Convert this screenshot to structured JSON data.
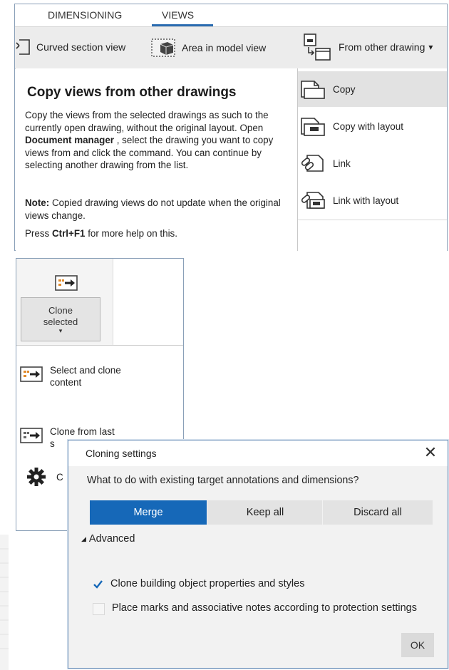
{
  "ribbon": {
    "tabs": [
      {
        "label": "DIMENSIONING"
      },
      {
        "label": "VIEWS"
      }
    ],
    "toolbar": {
      "curved_section": "Curved section view",
      "area_in_model": "Area in model view",
      "from_other_drawing": "From other drawing",
      "dropdown_caret": "▾"
    },
    "tooltip": {
      "title": "Copy views from other drawings",
      "body_part1": "Copy the views from the selected drawings as such to the currently open drawing, without the original layout. Open ",
      "body_bold": "Document manager",
      "body_part2": " , select the drawing you want to copy views from and click the command. You can continue by selecting another drawing from the list.",
      "note_label": "Note:",
      "note_text": " Copied drawing views do not update when the original views change.",
      "help_part1": "Press ",
      "help_shortcut": "Ctrl+F1",
      "help_part2": " for more help on this."
    },
    "menu": {
      "items": [
        {
          "label": "Copy",
          "icon": "copy-icon"
        },
        {
          "label": "Copy with layout",
          "icon": "copy-layout-icon"
        },
        {
          "label": "Link",
          "icon": "link-icon"
        },
        {
          "label": "Link with layout",
          "icon": "link-layout-icon"
        }
      ]
    }
  },
  "clone": {
    "button_line1": "Clone",
    "button_line2": "selected",
    "caret": "▾",
    "items": [
      {
        "label_line1": "Select and clone",
        "label_line2": "content"
      },
      {
        "label_line1": "Clone from last",
        "label_line2": "s"
      }
    ],
    "gear_partial": "C"
  },
  "dialog": {
    "title": "Cloning settings",
    "close": "✕",
    "question": "What to do with existing target annotations and dimensions?",
    "options": {
      "merge": "Merge",
      "keep_all": "Keep all",
      "discard_all": "Discard all",
      "selected": "merge"
    },
    "advanced": {
      "arrow": "◢",
      "label": "Advanced"
    },
    "checks": [
      {
        "label": "Clone building object properties and styles",
        "checked": true
      },
      {
        "label": "Place marks and associative notes according to protection settings",
        "checked": false
      }
    ],
    "ok": "OK",
    "accent_color": "#1668b8"
  }
}
